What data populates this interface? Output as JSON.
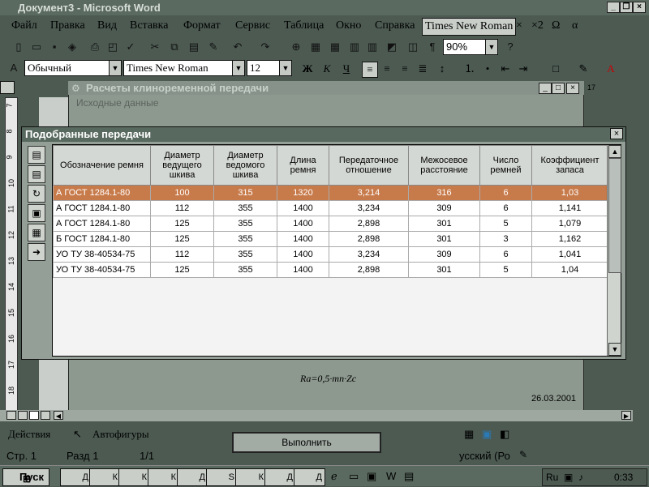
{
  "window": {
    "title": "Документ3 - Microsoft Word"
  },
  "menubar": {
    "items": [
      "Файл",
      "Правка",
      "Вид",
      "Вставка",
      "Формат",
      "Сервис",
      "Таблица",
      "Окно",
      "Справка"
    ],
    "font_display": "Times New Roman",
    "symbols": [
      "×",
      "×2",
      "Ω",
      "α"
    ]
  },
  "toolbar": {
    "zoom": "90%"
  },
  "formatting": {
    "style": "Обычный",
    "font": "Times New Roman",
    "size": "12",
    "bold": "Ж",
    "italic": "К",
    "underline": "Ч"
  },
  "ruler": {
    "numbers": [
      "7",
      "8",
      "9",
      "10",
      "11",
      "12",
      "13",
      "14",
      "15",
      "16",
      "17",
      "18"
    ],
    "top_marker": "17"
  },
  "background_dialog": {
    "title": "Расчеты клиноременной передачи",
    "subtitle": "Исходные данные"
  },
  "dialog": {
    "title": "Подобранные передачи",
    "columns": [
      "Обозначение ремня",
      "Диаметр ведущего шкива",
      "Диаметр ведомого шкива",
      "Длина ремня",
      "Передаточное отношение",
      "Межосевое расстояние",
      "Число ремней",
      "Коэффициент запаса"
    ],
    "rows": [
      [
        "А ГОСТ 1284.1-80",
        "100",
        "315",
        "1320",
        "3,214",
        "316",
        "6",
        "1,03"
      ],
      [
        "А ГОСТ 1284.1-80",
        "112",
        "355",
        "1400",
        "3,234",
        "309",
        "6",
        "1,141"
      ],
      [
        "А ГОСТ 1284.1-80",
        "125",
        "355",
        "1400",
        "2,898",
        "301",
        "5",
        "1,079"
      ],
      [
        "Б ГОСТ 1284.1-80",
        "125",
        "355",
        "1400",
        "2,898",
        "301",
        "3",
        "1,162"
      ],
      [
        "УО ТУ 38-40534-75",
        "112",
        "355",
        "1400",
        "3,234",
        "309",
        "6",
        "1,041"
      ],
      [
        "УО ТУ 38-40534-75",
        "125",
        "355",
        "1400",
        "2,898",
        "301",
        "5",
        "1,04"
      ]
    ],
    "selected_row": 0
  },
  "document": {
    "formula": "Ra=0,5·mп·Zc",
    "date": "26.03.2001"
  },
  "actions": {
    "execute": "Выполнить"
  },
  "drawing": {
    "actions": "Действия",
    "autoshapes": "Автофигуры"
  },
  "status": {
    "page": "Стр. 1",
    "section": "Разд 1",
    "pages": "1/1",
    "language": "усский (Ро"
  },
  "taskbar": {
    "start": "Пуск",
    "tray_lang": "Ru",
    "clock": "0:33",
    "tasks": [
      "Д",
      "К",
      "К",
      "К",
      "Д",
      "S",
      "К",
      "Д",
      "Д"
    ]
  }
}
